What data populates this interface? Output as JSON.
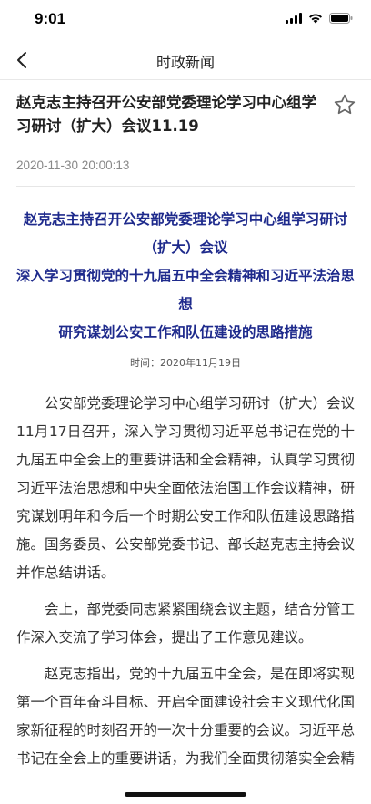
{
  "status_bar": {
    "time": "9:01"
  },
  "nav": {
    "title": "时政新闻",
    "back_icon": "chevron-left-icon"
  },
  "article": {
    "title": "赵克志主持召开公安部党委理论学习中心组学习研讨（扩大）会议11.19",
    "date": "2020-11-30 20:00:13",
    "favorite_icon": "star-outline-icon"
  },
  "content": {
    "headline_lines": [
      "赵克志主持召开公安部党委理论学习中心组学习研讨（扩大）会议",
      "深入学习贯彻党的十九届五中全会精神和习近平法治思想",
      "研究谋划公安工作和队伍建设的思路措施"
    ],
    "time_label": "时间：2020年11月19日",
    "paragraphs": [
      "公安部党委理论学习中心组学习研讨（扩大）会议11月17日召开，深入学习贯彻习近平总书记在党的十九届五中全会上的重要讲话和全会精神，认真学习贯彻习近平法治思想和中央全面依法治国工作会议精神，研究谋划明年和今后一个时期公安工作和队伍建设思路措施。国务委员、公安部党委书记、部长赵克志主持会议并作总结讲话。",
      "会上，部党委同志紧紧围绕会议主题，结合分管工作深入交流了学习体会，提出了工作意见建议。",
      "赵克志指出，党的十九届五中全会，是在即将实现第一个百年奋斗目标、开启全面建设社会主义现代化国家新征程的时刻召开的一次十分重要的会议。习近平总书记在全会上的重要讲话，为我们全面贯彻落实全会精神指明了方向。"
    ]
  }
}
